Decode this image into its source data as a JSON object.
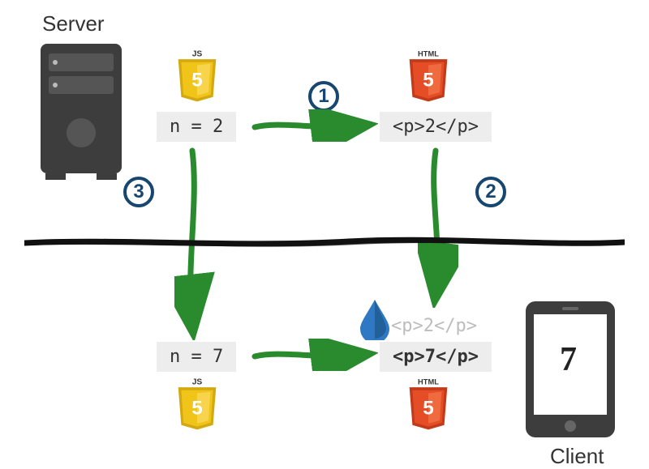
{
  "labels": {
    "server": "Server",
    "client": "Client"
  },
  "steps": {
    "one": "1",
    "two": "2",
    "three": "3"
  },
  "code": {
    "top_js": "n = 2",
    "top_html": "<p>2</p>",
    "ghost_html": "<p>2</p>",
    "bottom_js": "n = 7",
    "bottom_html": "<p>7</p>"
  },
  "badges": {
    "js": "JS",
    "html": "HTML"
  },
  "phone_display": "7",
  "colors": {
    "arrow": "#2a8a2e",
    "step_ring": "#17476f",
    "water": "#2f78c4",
    "js_shield": "#f0c419",
    "html_shield": "#e44d26",
    "code_bg": "#ededed",
    "device": "#3d3d3d"
  }
}
